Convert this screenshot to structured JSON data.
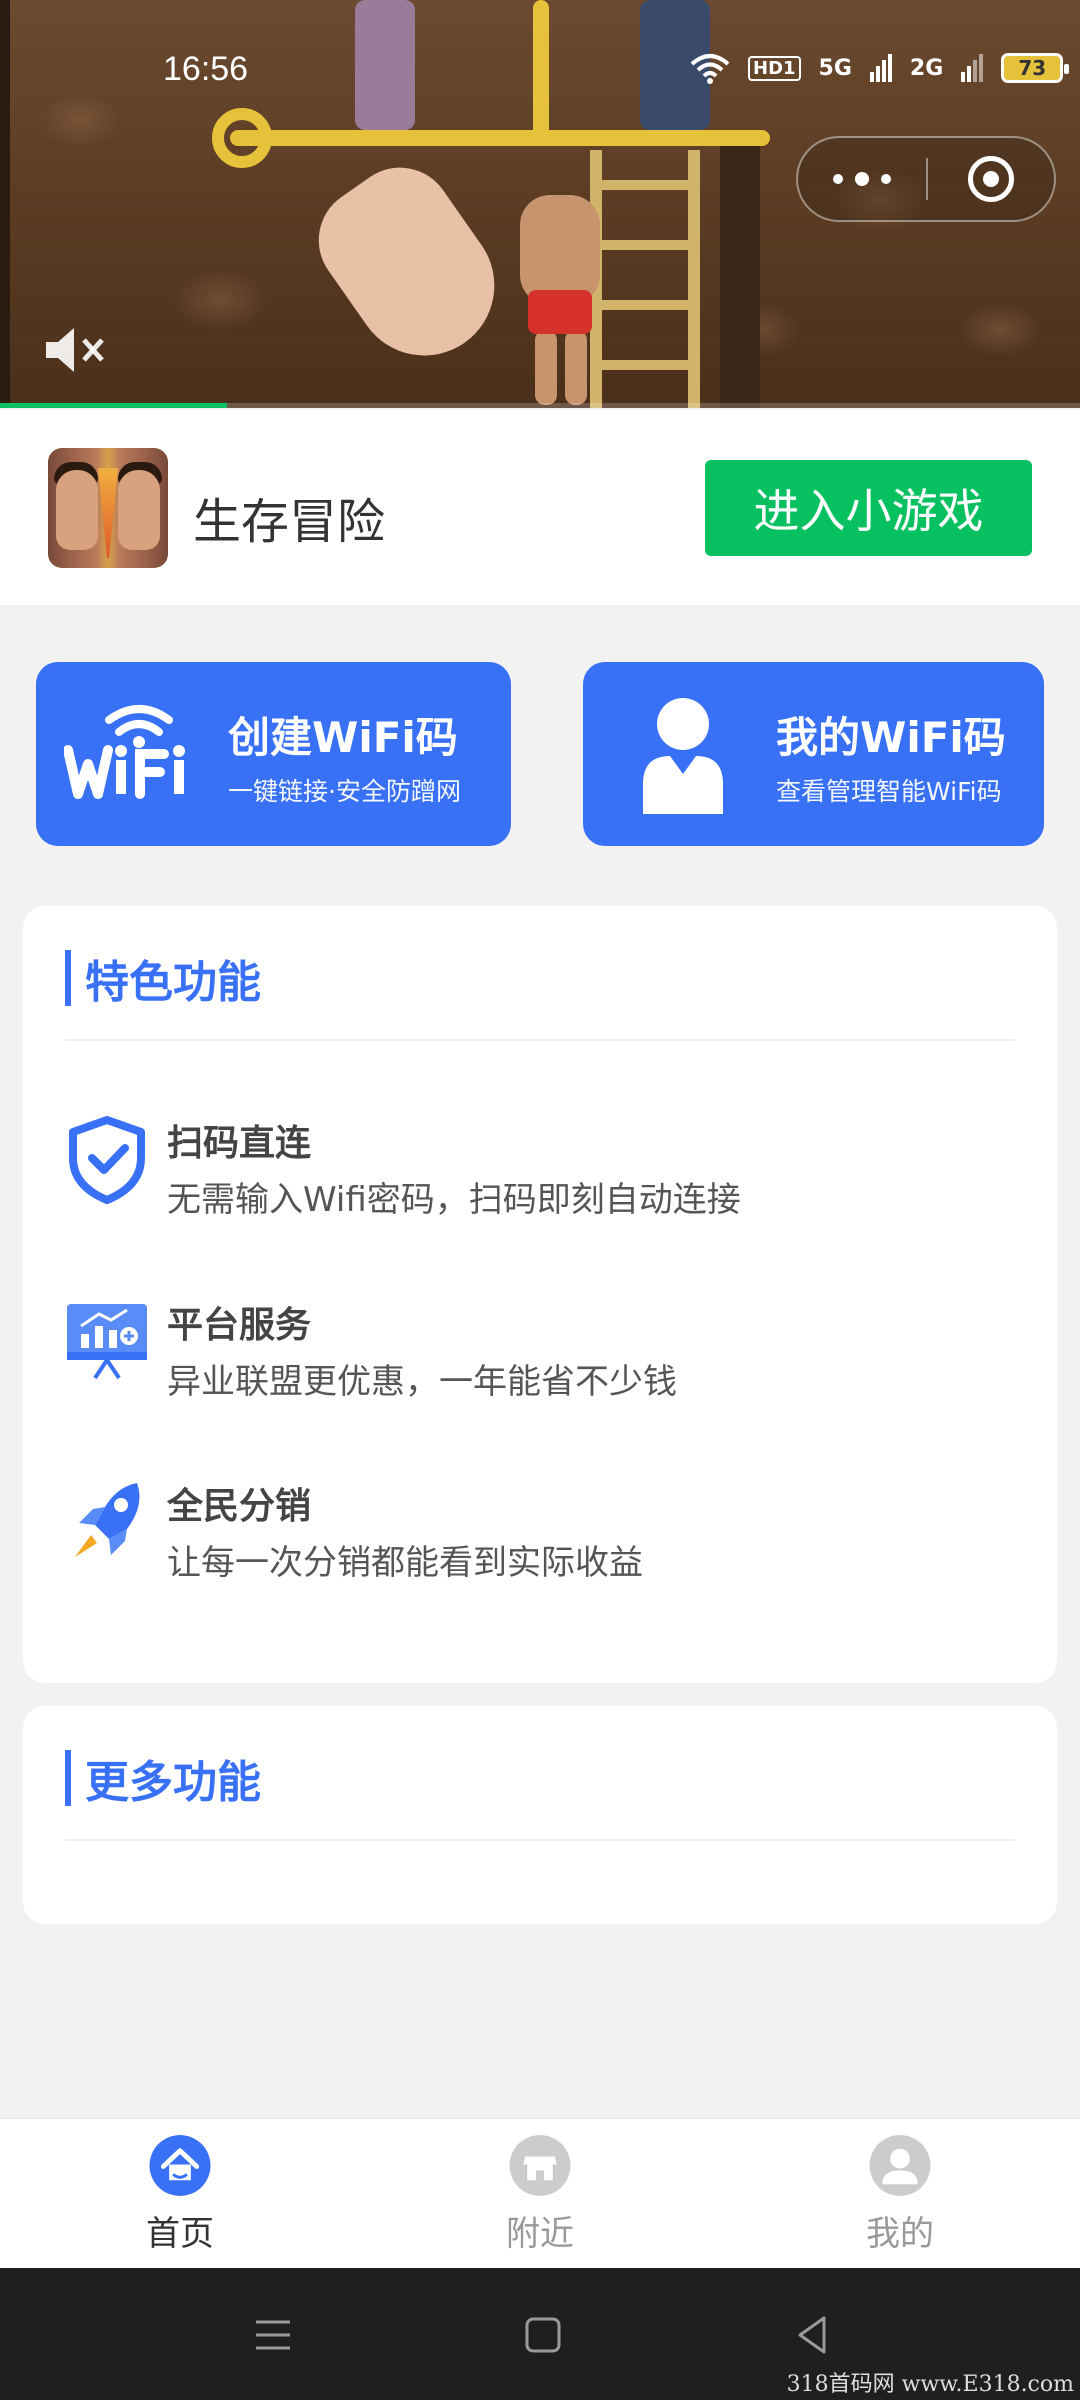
{
  "status_bar": {
    "time": "16:56",
    "network_labels": [
      "HD1",
      "5G",
      "2G"
    ],
    "battery": "73"
  },
  "video_ad": {
    "progress_fraction": 0.21,
    "muted": true
  },
  "game": {
    "title": "生存冒险",
    "enter_label": "进入小游戏"
  },
  "cards": [
    {
      "title": "创建WiFi码",
      "subtitle": "一键链接·安全防蹭网",
      "icon": "wifi-logo-icon"
    },
    {
      "title": "我的WiFi码",
      "subtitle": "查看管理智能WiFi码",
      "icon": "person-icon"
    }
  ],
  "features_section": {
    "heading": "特色功能",
    "items": [
      {
        "title": "扫码直连",
        "description": "无需输入Wifi密码，扫码即刻自动连接",
        "icon": "shield-check-icon"
      },
      {
        "title": "平台服务",
        "description": "异业联盟更优惠，一年能省不少钱",
        "icon": "presentation-board-icon"
      },
      {
        "title": "全民分销",
        "description": "让每一次分销都能看到实际收益",
        "icon": "rocket-icon"
      }
    ]
  },
  "more_section": {
    "heading": "更多功能"
  },
  "tabbar": {
    "tabs": [
      {
        "label": "首页",
        "icon": "home-icon",
        "active": true
      },
      {
        "label": "附近",
        "icon": "store-icon",
        "active": false
      },
      {
        "label": "我的",
        "icon": "user-icon",
        "active": false
      }
    ]
  },
  "watermark": "318首码网 www.E318.com",
  "colors": {
    "primary_blue": "#3870f6",
    "wechat_green": "#07c160"
  }
}
